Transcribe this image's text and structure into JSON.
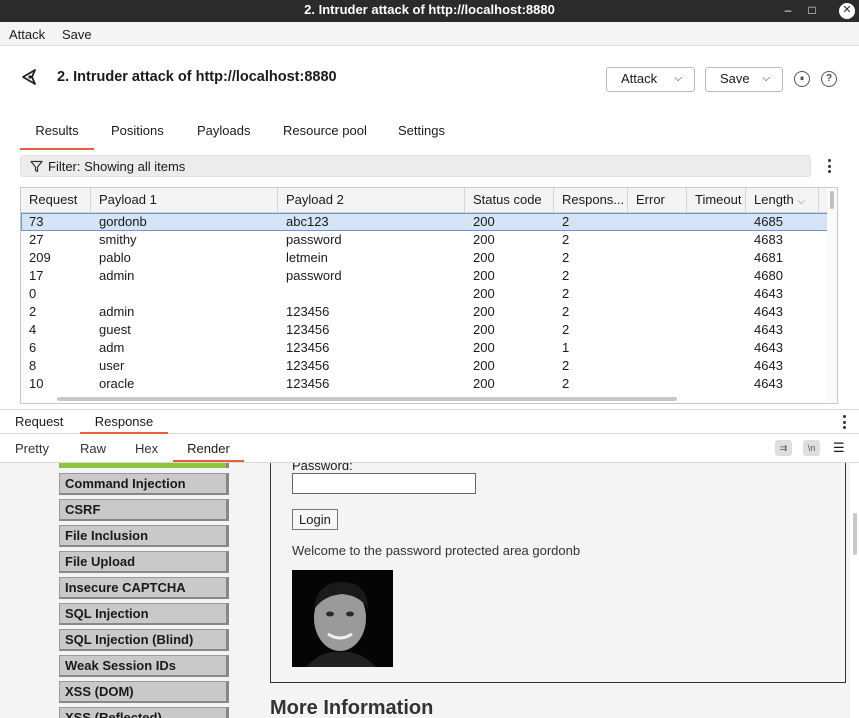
{
  "window": {
    "title": "2. Intruder attack of http://localhost:8880",
    "minimize": "–",
    "maximize": "□",
    "close": "✕"
  },
  "menu": {
    "attack": "Attack",
    "save": "Save"
  },
  "header": {
    "title": "2. Intruder attack of http://localhost:8880",
    "attack_btn": "Attack",
    "save_btn": "Save",
    "chevron": "⌵",
    "pause_icon": "⏸",
    "help_icon": "?"
  },
  "tabs": [
    "Results",
    "Positions",
    "Payloads",
    "Resource pool",
    "Settings"
  ],
  "filter": {
    "text": "Filter: Showing all items"
  },
  "table": {
    "columns": [
      "Request",
      "Payload 1",
      "Payload 2",
      "Status code",
      "Respons...",
      "Error",
      "Timeout",
      "Length"
    ],
    "sort_indicator": "⌵",
    "rows": [
      [
        "73",
        "gordonb",
        "abc123",
        "200",
        "2",
        "",
        "",
        "4685"
      ],
      [
        "27",
        "smithy",
        "password",
        "200",
        "2",
        "",
        "",
        "4683"
      ],
      [
        "209",
        "pablo",
        "letmein",
        "200",
        "2",
        "",
        "",
        "4681"
      ],
      [
        "17",
        "admin",
        "password",
        "200",
        "2",
        "",
        "",
        "4680"
      ],
      [
        "0",
        "",
        "",
        "200",
        "2",
        "",
        "",
        "4643"
      ],
      [
        "2",
        "admin",
        "123456",
        "200",
        "2",
        "",
        "",
        "4643"
      ],
      [
        "4",
        "guest",
        "123456",
        "200",
        "2",
        "",
        "",
        "4643"
      ],
      [
        "6",
        "adm",
        "123456",
        "200",
        "1",
        "",
        "",
        "4643"
      ],
      [
        "8",
        "user",
        "123456",
        "200",
        "2",
        "",
        "",
        "4643"
      ],
      [
        "10",
        "oracle",
        "123456",
        "200",
        "2",
        "",
        "",
        "4643"
      ]
    ]
  },
  "rr_tabs": {
    "request": "Request",
    "response": "Response"
  },
  "view_tabs": {
    "pretty": "Pretty",
    "raw": "Raw",
    "hex": "Hex",
    "render": "Render",
    "wrap_icon": "⇉",
    "newline_icon": "\\n",
    "menu_icon": "☰"
  },
  "render": {
    "menu_items": [
      "Command Injection",
      "CSRF",
      "File Inclusion",
      "File Upload",
      "Insecure CAPTCHA",
      "SQL Injection",
      "SQL Injection (Blind)",
      "Weak Session IDs",
      "XSS (DOM)",
      "XSS (Reflected)"
    ],
    "password_label": "Password:",
    "login_btn": "Login",
    "welcome": "Welcome to the password protected area gordonb",
    "more_info": "More Information"
  }
}
